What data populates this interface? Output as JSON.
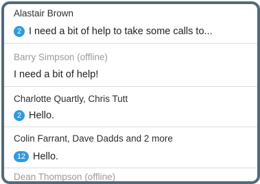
{
  "conversations": [
    {
      "name": "Alastair Brown",
      "unread": "2",
      "message": "I need a bit of help to take some calls to..."
    },
    {
      "name": "Barry Simpson (offline)",
      "message": "I need a bit of help!"
    },
    {
      "name": "Charlotte Quartly, Chris Tutt",
      "unread": "2",
      "message": "Hello."
    },
    {
      "name": "Colin Farrant, Dave Dadds and 2 more",
      "unread": "12",
      "message": "Hello."
    },
    {
      "name": "Dean Thompson (offline)"
    }
  ],
  "colors": {
    "badge": "#2f9be0",
    "frame": "#4f6b7d",
    "offline_text": "#9a9a9a"
  }
}
